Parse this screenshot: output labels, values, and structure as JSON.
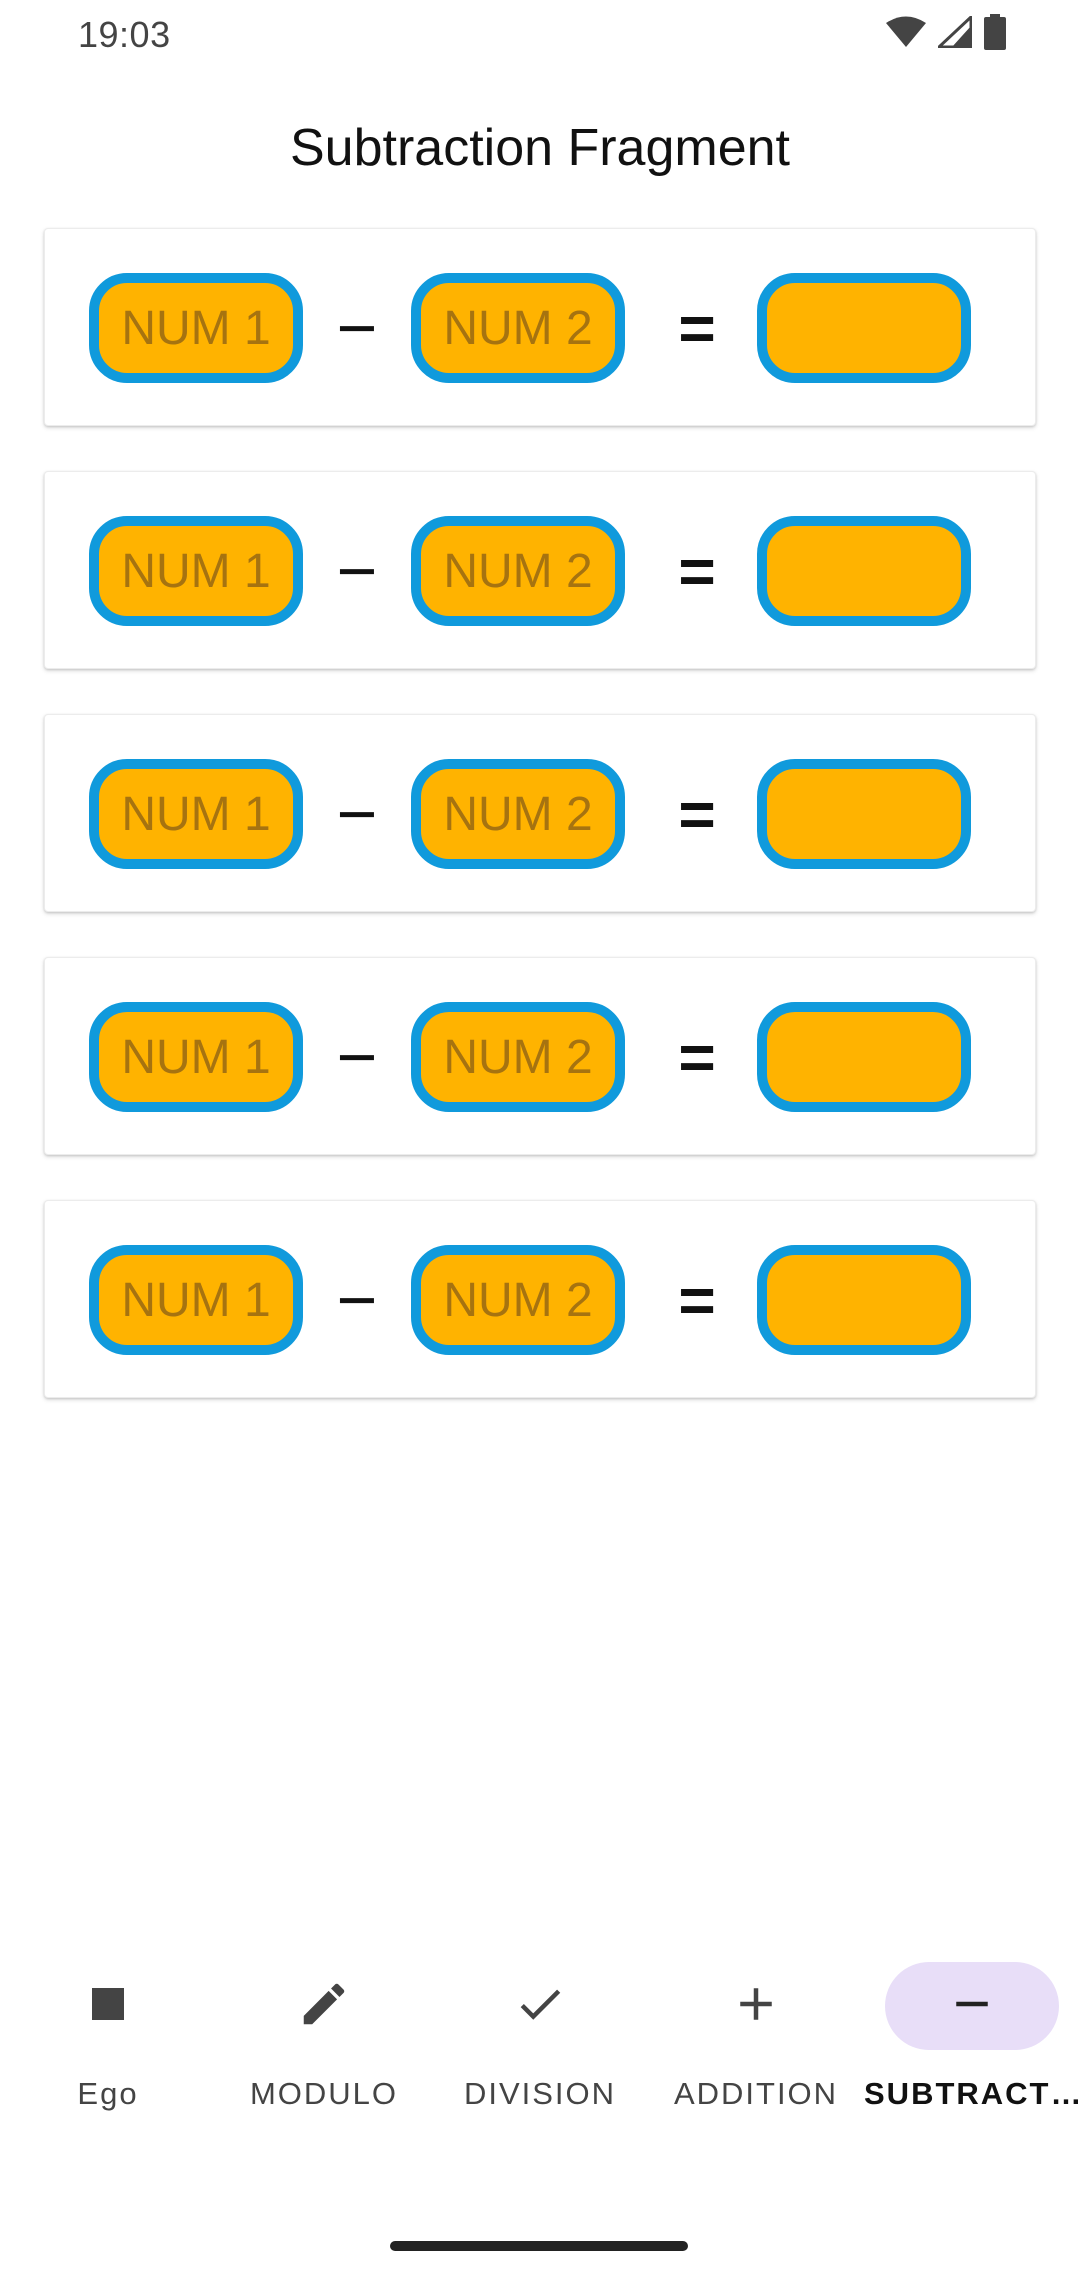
{
  "status": {
    "time": "19:03"
  },
  "title": "Subtraction Fragment",
  "equations": [
    {
      "num1": "NUM 1",
      "operator": "−",
      "num2": "NUM 2",
      "equals": "=",
      "result": ""
    },
    {
      "num1": "NUM 1",
      "operator": "−",
      "num2": "NUM 2",
      "equals": "=",
      "result": ""
    },
    {
      "num1": "NUM 1",
      "operator": "−",
      "num2": "NUM 2",
      "equals": "=",
      "result": ""
    },
    {
      "num1": "NUM 1",
      "operator": "−",
      "num2": "NUM 2",
      "equals": "=",
      "result": ""
    },
    {
      "num1": "NUM 1",
      "operator": "−",
      "num2": "NUM 2",
      "equals": "=",
      "result": ""
    }
  ],
  "nav": {
    "items": [
      {
        "label": "Ego",
        "icon": "stop-square-icon",
        "active": false
      },
      {
        "label": "MODULO",
        "icon": "pencil-icon",
        "active": false
      },
      {
        "label": "DIVISION",
        "icon": "check-icon",
        "active": false
      },
      {
        "label": "ADDITION",
        "icon": "plus-icon",
        "active": false
      },
      {
        "label": "SUBTRACT…",
        "icon": "minus-icon",
        "active": true
      }
    ]
  },
  "colors": {
    "pill_fill": "#ffb300",
    "pill_border": "#109adc",
    "pill_hint_text": "#a67310",
    "nav_active_bg": "#e8def8"
  }
}
